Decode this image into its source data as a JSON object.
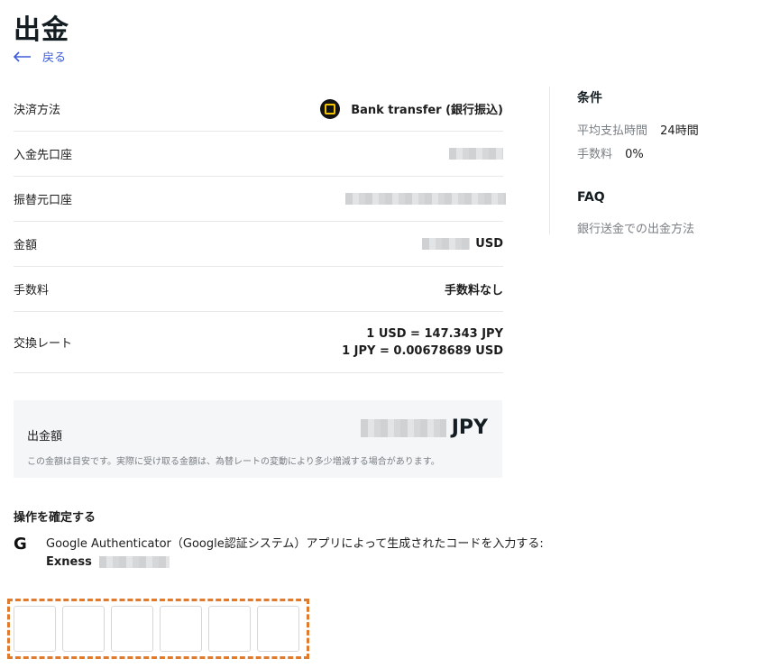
{
  "page": {
    "title": "出金",
    "back_label": "戻る"
  },
  "details": {
    "rows": [
      {
        "label": "決済方法",
        "value": "Bank transfer (銀行振込)"
      },
      {
        "label": "入金先口座",
        "value": ""
      },
      {
        "label": "振替元口座",
        "value": ""
      },
      {
        "label": "金額",
        "value": "USD"
      },
      {
        "label": "手数料",
        "value": "手数料なし"
      },
      {
        "label": "交換レート",
        "value_line1": "1 USD = 147.343 JPY",
        "value_line2": "1 JPY = 0.00678689 USD"
      }
    ]
  },
  "amount": {
    "label": "出金額",
    "currency": "JPY",
    "note": "この金額は目安です。実際に受け取る金額は、為替レートの変動により多少増減する場合があります。"
  },
  "confirm": {
    "title": "操作を確定する",
    "auth_text": "Google Authenticator（Google認証システム）アプリによって生成されたコードを入力する:",
    "account_prefix": "Exness"
  },
  "otp": {
    "digits": [
      "",
      "",
      "",
      "",
      "",
      ""
    ]
  },
  "sidebar": {
    "conditions_title": "条件",
    "conditions": [
      {
        "key": "平均支払時間",
        "value": "24時間"
      },
      {
        "key": "手数料",
        "value": "0%"
      }
    ],
    "faq_title": "FAQ",
    "faq_link": "銀行送金での出金方法"
  },
  "colors": {
    "accent": "#3b5bdb",
    "highlight_border": "#e07b2e",
    "bank_icon": "#f5c400"
  }
}
